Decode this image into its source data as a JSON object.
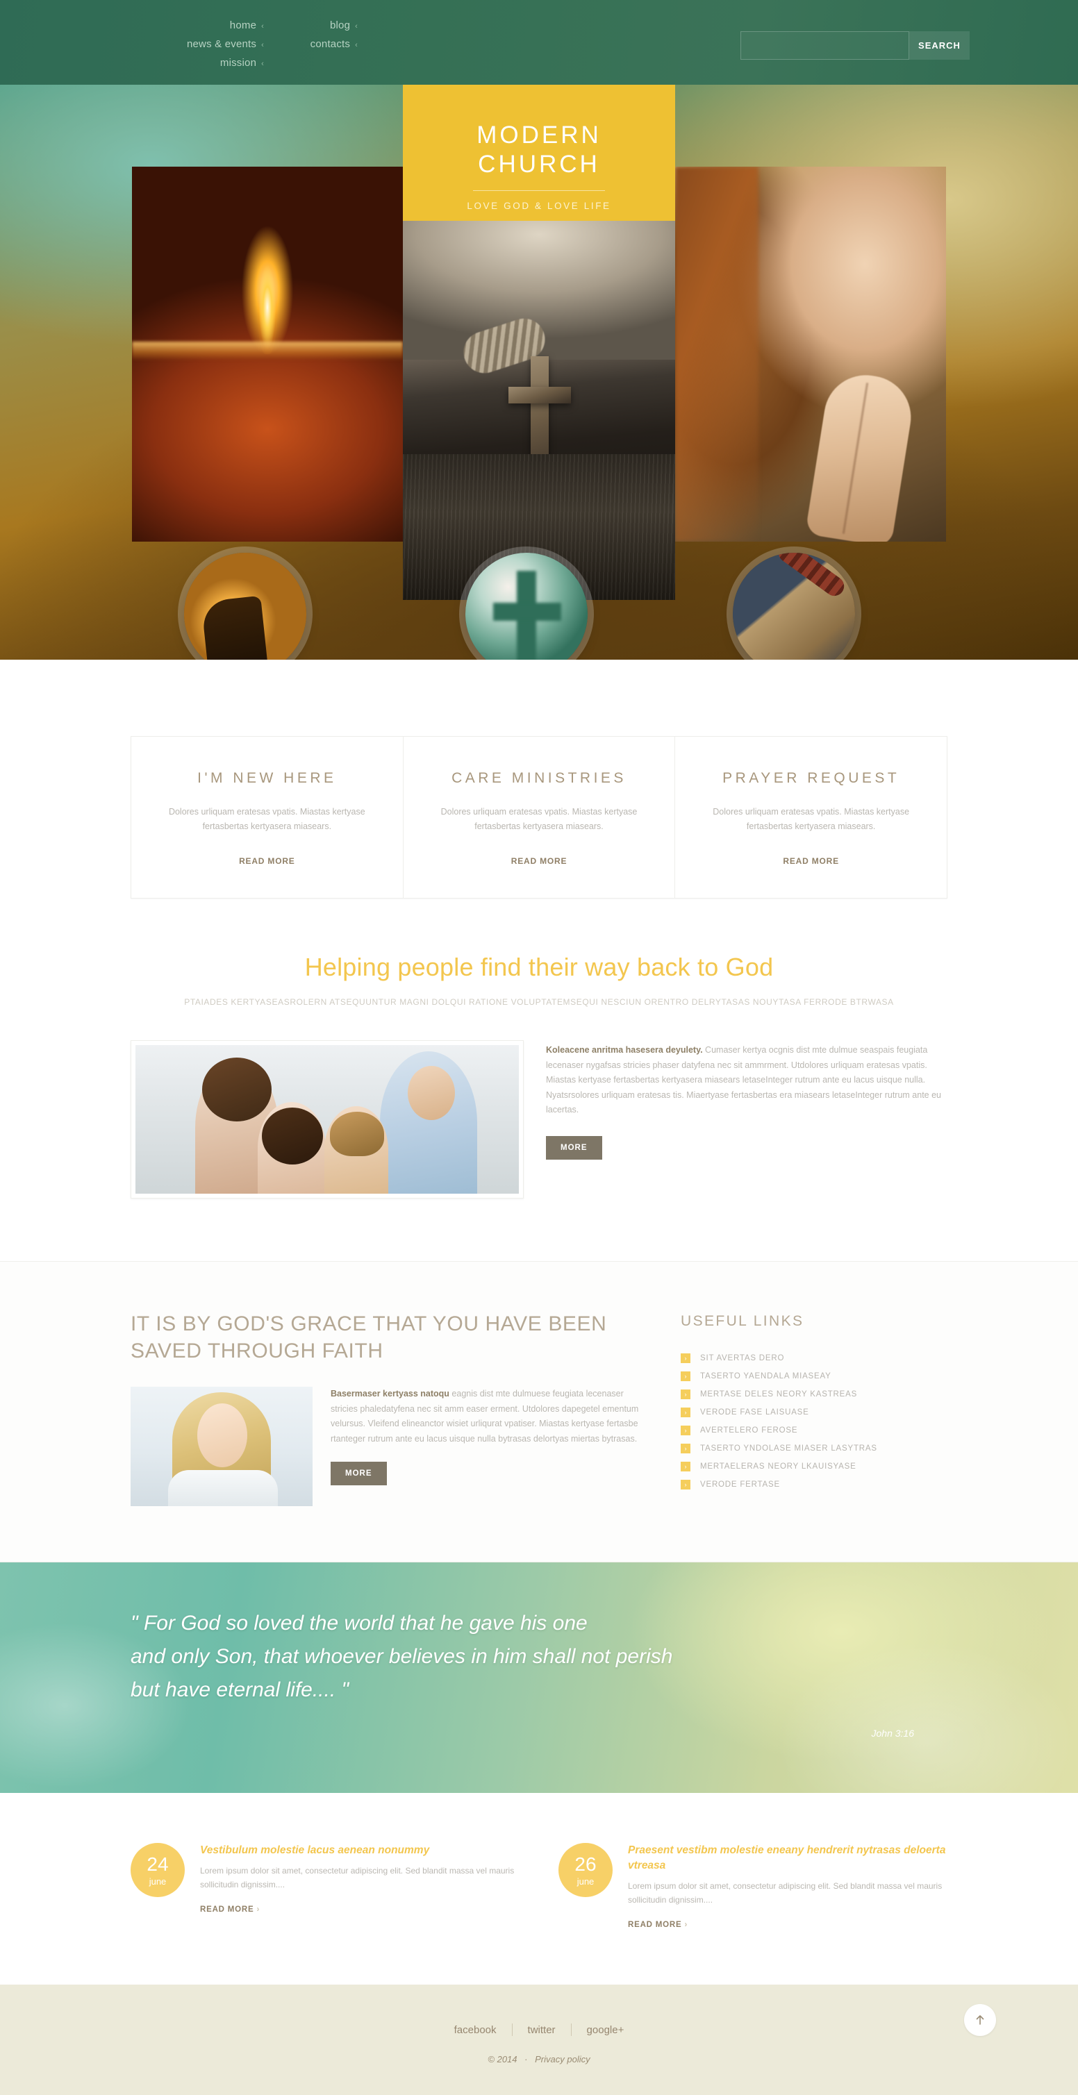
{
  "header": {
    "logo": {
      "line1": "MODERN",
      "line2": "CHURCH",
      "tagline": "LOVE GOD & LOVE LIFE"
    },
    "nav_col1": [
      {
        "label": "home",
        "caret": "‹"
      },
      {
        "label": "news & events",
        "caret": "‹"
      },
      {
        "label": "mission",
        "caret": "‹"
      }
    ],
    "nav_col2": [
      {
        "label": "blog",
        "caret": "‹"
      },
      {
        "label": "contacts",
        "caret": "‹"
      }
    ],
    "search": {
      "value": "",
      "placeholder": "",
      "button_label": "SEARCH"
    }
  },
  "hero": {
    "photos": [
      {
        "name": "candle-photo"
      },
      {
        "name": "bible-cross-photo"
      },
      {
        "name": "praying-woman-photo"
      }
    ]
  },
  "features": [
    {
      "icon": "hand-reaching-light-icon",
      "title": "I'M NEW HERE",
      "text": "Dolores urliquam eratesas vpatis. Miastas kertyase fertasbertas kertyasera miasears.",
      "link": "READ MORE"
    },
    {
      "icon": "cross-silhouette-icon",
      "title": "CARE MINISTRIES",
      "text": "Dolores urliquam eratesas vpatis. Miastas kertyase fertasbertas kertyasera miasears.",
      "link": "READ MORE"
    },
    {
      "icon": "rosary-beads-icon",
      "title": "PRAYER REQUEST",
      "text": "Dolores urliquam eratesas vpatis. Miastas kertyase fertasbertas kertyasera miasears.",
      "link": "READ MORE"
    }
  ],
  "helping": {
    "title": "Helping people find their way back to God",
    "subtitle": "PTAIADES KERTYASEASROLERN ATSEQUUNTUR MAGNI DOLQUI RATIONE VOLUPTATEMSEQUI NESCIUN ORENTRO DELRYTASAS NOUYTASA FERRODE BTRWASA",
    "promo": {
      "image_name": "family-photo",
      "lead": "Koleacene anritma hasesera deyulety.",
      "text": " Cumaser kertya ocgnis dist mte dulmue seaspais feugiata lecenaser nygafsas stricies phaser datyfena nec sit ammrment. Utdolores urliquam eratesas vpatis. Miastas kertyase fertasbertas kertyasera miasears letaseInteger rutrum ante eu lacus uisque nulla. Nyatsrsolores urliquam eratesas tis. Miaertyase fertasbertas era miasears letaseInteger rutrum ante eu lacertas.",
      "button": "MORE"
    }
  },
  "grace": {
    "title": "IT IS BY GOD'S GRACE THAT YOU HAVE BEEN SAVED THROUGH FAITH",
    "image_name": "smiling-woman-photo",
    "lead": "Basermaser kertyass natoqu",
    "text": " eagnis dist mte dulmuese feugiata lecenaser stricies phaledatyfena nec sit amm easer erment. Utdolores dapegetel ementum velursus. Vleifend elineanctor wisiet urliqurat vpatiser. Miastas kertyase fertasbe rtanteger rutrum ante eu lacus uisque nulla bytrasas delortyas miertas bytrasas.",
    "button": "MORE",
    "links_title": "USEFUL LINKS",
    "links": [
      "SIT AVERTAS DERO",
      "TASERTO YAENDALA MIASEAY",
      "MERTASE DELES NEORY KASTREAS",
      "VERODE FASE LAISUASE",
      "AVERTELERO FEROSE",
      "TASERTO YNDOLASE MIASER LASYTRAS",
      "MERTAELERAS NEORY LKAUISYASE",
      "VERODE FERTASE"
    ],
    "link_bullet": "›"
  },
  "quote": {
    "line1": "\" For God so loved the world that he gave his one",
    "line2": "and only Son, that whoever believes in him shall not perish",
    "line3": "but have eternal life.... \"",
    "author": "John 3:16"
  },
  "news": [
    {
      "day": "24",
      "month": "june",
      "title": "Vestibulum molestie lacus aenean nonummy",
      "text": "Lorem ipsum dolor sit amet, consectetur adipiscing elit. Sed blandit massa vel mauris sollicitudin dignissim....",
      "link": "READ MORE",
      "chevron": "›"
    },
    {
      "day": "26",
      "month": "june",
      "title": "Praesent vestibm molestie eneany hendrerit nytrasas deloerta vtreasa",
      "text": "Lorem ipsum dolor sit amet, consectetur adipiscing elit. Sed blandit massa vel mauris sollicitudin dignissim....",
      "link": "READ MORE",
      "chevron": "›"
    }
  ],
  "footer": {
    "social": [
      {
        "label": "facebook"
      },
      {
        "label": "twitter"
      },
      {
        "label": "google+"
      }
    ],
    "copyright": "© 2014",
    "dot": "·",
    "privacy": "Privacy policy",
    "totop_icon": "arrow-up-icon"
  },
  "colors": {
    "header_green": "#35705a",
    "logo_yellow": "#eec133",
    "accent_yellow": "#f3c64e",
    "brown_text": "#8e8067",
    "footer_bg": "#ecead9"
  }
}
